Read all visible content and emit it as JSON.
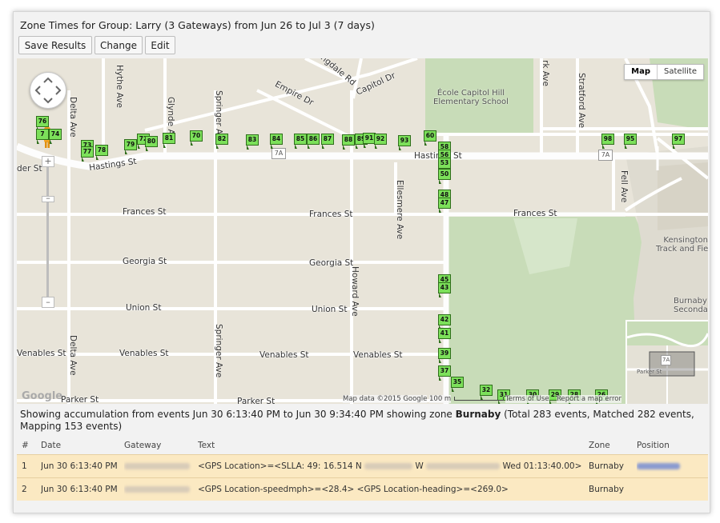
{
  "title": "Zone Times for Group: Larry (3 Gateways) from Jun 26 to Jul 3 (7 days)",
  "toolbar": {
    "save_label": "Save Results",
    "change_label": "Change",
    "edit_label": "Edit"
  },
  "map": {
    "type_map": "Map",
    "type_satellite": "Satellite",
    "streets": {
      "hastings_w": "Hastings St",
      "hastings_e": "Hastings St",
      "frances_w": "Frances St",
      "frances_m": "Frances St",
      "frances_e": "Frances St",
      "georgia_w": "Georgia St",
      "georgia_m": "Georgia St",
      "union_w": "Union St",
      "union_m": "Union St",
      "venables_w": "Venables St",
      "venables_m": "Venables St",
      "venables_m2": "Venables St",
      "parker_w": "Parker St",
      "parker_m": "Parker St",
      "capitol": "Capitol Dr",
      "empire": "Empire Dr",
      "lingdale": "ingdale Rd",
      "der": "der St",
      "delta": "Delta Ave",
      "delta2": "Delta Ave",
      "hythe": "Hythe Ave",
      "glynde": "Glynde Ave",
      "springer": "Springer Ave",
      "springer2": "Springer Ave",
      "howard": "Howard Ave",
      "ellesmere": "Ellesmere Ave",
      "stratford": "Stratford Ave",
      "fell": "Fell Ave",
      "rk": "rk Ave"
    },
    "pois": {
      "school_1": "École Capitol Hill",
      "school_2": "Elementary School",
      "kensington_1": "Kensington",
      "kensington_2": "Track and Field",
      "burnaby_1": "Burnaby",
      "burnaby_2": "Secondar"
    },
    "shields": [
      "7A",
      "7A"
    ],
    "scale_label": "100 m",
    "map_data": "Map data ©2015 Google",
    "terms": "Terms of Use",
    "report": "Report a map error",
    "google_logo": "Google",
    "markers": [
      "76",
      "7",
      "74",
      "73",
      "77",
      "78",
      "79",
      "72",
      "80",
      "81",
      "70",
      "82",
      "83",
      "84",
      "85",
      "86",
      "87",
      "88",
      "89",
      "91",
      "92",
      "93",
      "60",
      "58",
      "56",
      "53",
      "50",
      "48",
      "47",
      "45",
      "43",
      "42",
      "41",
      "39",
      "37",
      "35",
      "32",
      "31",
      "30",
      "29",
      "28",
      "26",
      "98",
      "95",
      "97"
    ]
  },
  "summary": {
    "prefix": "Showing accumulation from events Jun 30 6:13:40 PM to Jun 30 9:34:40 PM showing zone ",
    "zone": "Burnaby",
    "suffix": " (Total 283 events, Matched 282 events, Mapping 153 events)"
  },
  "table": {
    "headers": {
      "num": "#",
      "date": "Date",
      "gateway": "Gateway",
      "text": "Text",
      "zone": "Zone",
      "position": "Position"
    },
    "rows": [
      {
        "num": "1",
        "date": "Jun 30 6:13:40 PM",
        "text_a": "<GPS Location>=<SLLA: 49: 16.514 N",
        "text_b": "W",
        "text_c": "Wed 01:13:40.00>",
        "zone": "Burnaby"
      },
      {
        "num": "2",
        "date": "Jun 30 6:13:40 PM",
        "text_a": "<GPS Location-speedmph>=<28.4> <GPS Location-heading>=<269.0>",
        "text_b": "",
        "text_c": "",
        "zone": "Burnaby"
      }
    ]
  },
  "colors": {
    "marker_fill": "#7ce05a",
    "marker_border": "#2f6e1b",
    "park": "#c8dcb8",
    "road": "#ffffff",
    "highway": "#fdfdfd",
    "row_highlight": "#fbe9c2"
  }
}
